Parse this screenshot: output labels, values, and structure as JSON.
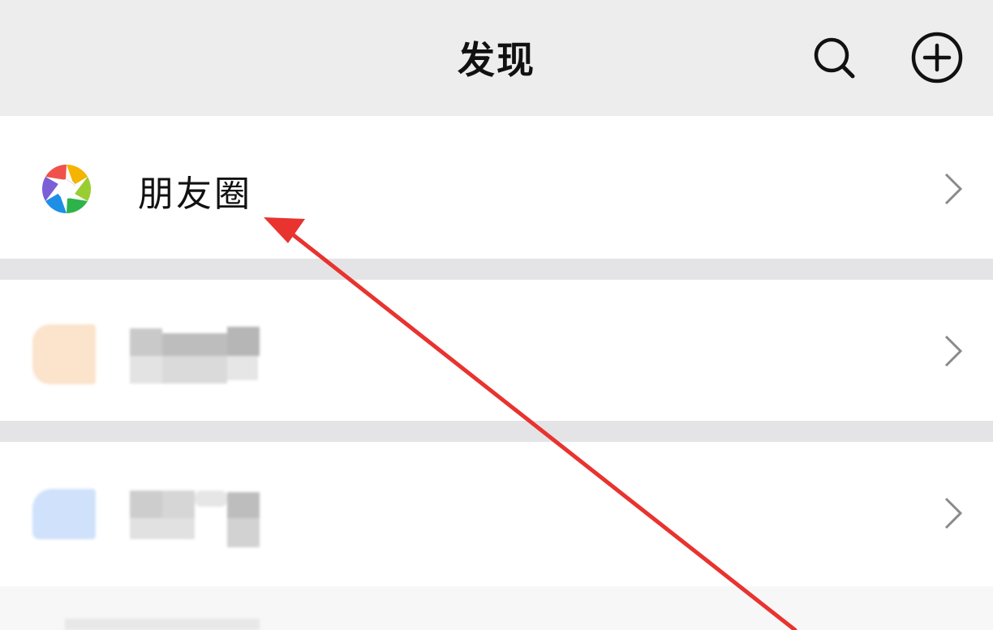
{
  "header": {
    "title": "发现",
    "search_icon": "search-icon",
    "add_icon": "plus-circle-icon"
  },
  "menu": {
    "items": [
      {
        "label": "朋友圈",
        "icon": "moments-aperture-icon"
      },
      {
        "label": "",
        "icon": "blurred-icon"
      },
      {
        "label": "",
        "icon": "blurred-icon"
      }
    ]
  },
  "colors": {
    "background": "#ededed",
    "row_background": "#ffffff",
    "annotation_arrow": "#e8332f"
  }
}
